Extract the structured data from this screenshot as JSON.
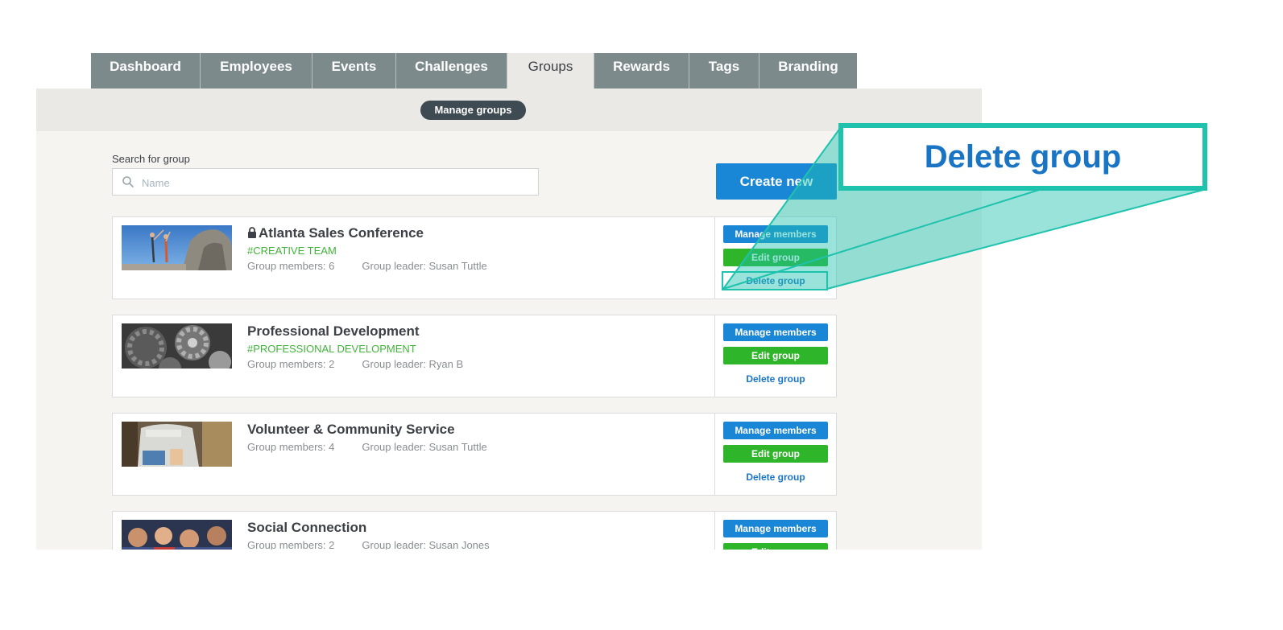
{
  "tabs": [
    {
      "label": "Dashboard",
      "active": false
    },
    {
      "label": "Employees",
      "active": false
    },
    {
      "label": "Events",
      "active": false
    },
    {
      "label": "Challenges",
      "active": false
    },
    {
      "label": "Groups",
      "active": true
    },
    {
      "label": "Rewards",
      "active": false
    },
    {
      "label": "Tags",
      "active": false
    },
    {
      "label": "Branding",
      "active": false
    }
  ],
  "subnav": {
    "pill_label": "Manage groups"
  },
  "search": {
    "label": "Search for group",
    "placeholder": "Name",
    "value": ""
  },
  "create_button": "Create new",
  "groups": [
    {
      "title": "Atlanta Sales Conference",
      "locked": true,
      "tag": "#CREATIVE TEAM",
      "members": "Group members: 6",
      "leader": "Group leader: Susan Tuttle",
      "image": "climbers-on-rock-photo"
    },
    {
      "title": "Professional Development",
      "locked": false,
      "tag": "#PROFESSIONAL DEVELOPMENT",
      "members": "Group members: 2",
      "leader": "Group leader: Ryan B",
      "image": "gears-photo"
    },
    {
      "title": "Volunteer & Community Service",
      "locked": false,
      "tag": "",
      "members": "Group members: 4",
      "leader": "Group leader: Susan Tuttle",
      "image": "volunteer-shirt-photo"
    },
    {
      "title": "Social Connection",
      "locked": false,
      "tag": "",
      "members": "Group members: 2",
      "leader": "Group leader: Susan Jones",
      "image": "group-of-friends-photo"
    }
  ],
  "actions": {
    "manage": "Manage members",
    "edit": "Edit group",
    "delete": "Delete group"
  },
  "callout": {
    "text": "Delete group"
  },
  "colors": {
    "tab_bg": "#7d8a8b",
    "primary_blue": "#1a86d6",
    "edit_green": "#2fb52a",
    "tag_green": "#41b43a",
    "callout_teal": "#1fc2ad",
    "panel_bg": "#f5f4f1"
  }
}
